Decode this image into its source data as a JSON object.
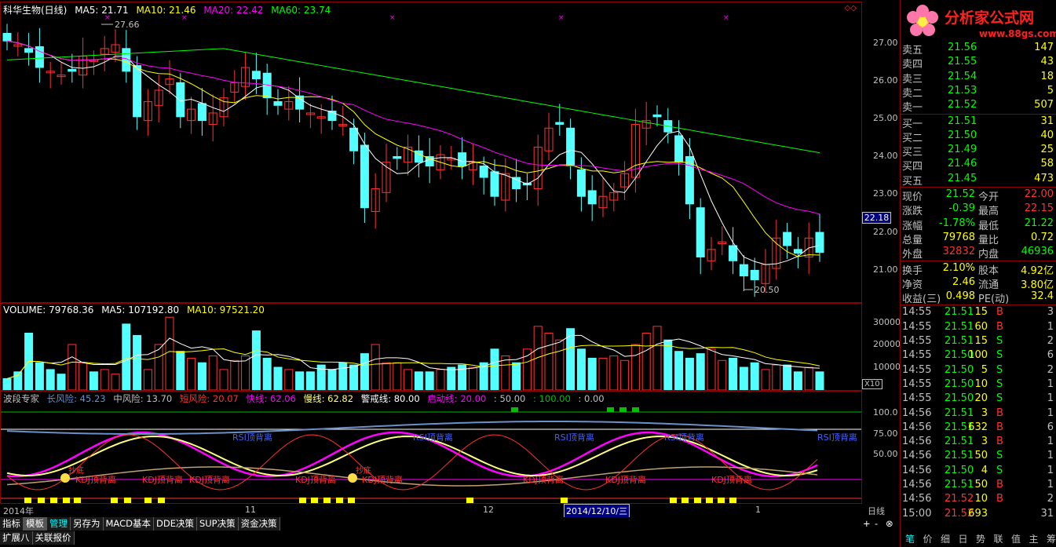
{
  "main": {
    "title": "科华生物(日线)",
    "ma5": "MA5: 21.71",
    "ma10": "MA10: 21.46",
    "ma20": "MA20: 22.42",
    "ma60": "MA60: 23.74",
    "high_note": "27.66",
    "low_note": "20.50",
    "current_price_tag": "22.18",
    "y_ticks": [
      "27.00",
      "26.00",
      "25.00",
      "24.00",
      "23.00",
      "22.00",
      "21.00"
    ]
  },
  "volume": {
    "title": "VOLUME: 79768.36",
    "ma5": "MA5: 107192.80",
    "ma10": "MA10: 97521.20",
    "y_ticks": [
      "30000",
      "20000",
      "10000"
    ],
    "unit": "X10"
  },
  "indicator": {
    "name": "波段专家",
    "long_risk": "长风险: 45.23",
    "mid_risk": "中风险: 13.70",
    "short_risk": "短风险: 20.07",
    "fast": "快线: 62.06",
    "slow": "慢线: 62.82",
    "warn": "警戒线: 80.00",
    "start": "启动线: 20.00",
    "v1": ": 50.00",
    "v2": ": 100.00",
    "v3": ": 0.00",
    "y_ticks": [
      "100.0",
      "75.00",
      "50.00"
    ],
    "labels_rsi": [
      "RSI顶背离",
      "RSI顶背离",
      "RSI顶背离",
      "RSI顶背离",
      "RSI顶背离"
    ],
    "labels_kdj": [
      "KDJ顶背离",
      "KDJ顶背离",
      "KDJ顶背离",
      "KDJ顶背离",
      "KDJ顶背离",
      "KDJ顶背离",
      "KDJ顶背离",
      "KDJ顶背离"
    ],
    "label_buy": "抄底"
  },
  "time_axis": {
    "labels": [
      "2014年",
      "11",
      "12",
      "1"
    ],
    "cursor_date": "2014/12/10/三",
    "period": "日线"
  },
  "tabs": [
    "指标",
    "模板",
    "管理",
    "另存为",
    "MACD基本",
    "DDE决策",
    "SUP决策",
    "资金决策"
  ],
  "tabs2": [
    "扩展八",
    "关联报价"
  ],
  "zoom": [
    "+",
    "-",
    "⊗"
  ],
  "logo": {
    "text": "分析家公式网",
    "url": "www.88gs.com"
  },
  "order_book": {
    "sell": [
      [
        "卖五",
        "21.56",
        "147"
      ],
      [
        "卖四",
        "21.55",
        "43"
      ],
      [
        "卖三",
        "21.54",
        "18"
      ],
      [
        "卖二",
        "21.53",
        "5"
      ],
      [
        "卖一",
        "21.52",
        "507"
      ]
    ],
    "buy": [
      [
        "买一",
        "21.51",
        "31"
      ],
      [
        "买二",
        "21.50",
        "40"
      ],
      [
        "买三",
        "21.49",
        "25"
      ],
      [
        "买四",
        "21.46",
        "58"
      ],
      [
        "买五",
        "21.45",
        "473"
      ]
    ]
  },
  "quote": [
    [
      "现价",
      "21.52",
      "今开",
      "22.00"
    ],
    [
      "涨跌",
      "-0.39",
      "最高",
      "22.15"
    ],
    [
      "涨幅",
      "-1.78%",
      "最低",
      "21.22"
    ],
    [
      "总量",
      "79768",
      "量比",
      "0.72"
    ],
    [
      "外盘",
      "32832",
      "内盘",
      "46936"
    ]
  ],
  "quote2": [
    [
      "换手",
      "2.10%",
      "股本",
      "4.92亿"
    ],
    [
      "净资",
      "2.46",
      "流通",
      "3.80亿"
    ],
    [
      "收益(三)",
      "0.498",
      "PE(动)",
      "32.4"
    ]
  ],
  "ticks": [
    [
      "14:55",
      "21.51",
      "15",
      "B",
      "3"
    ],
    [
      "14:55",
      "21.51",
      "60",
      "B",
      "1"
    ],
    [
      "14:55",
      "21.51",
      "15",
      "S",
      "2"
    ],
    [
      "14:55",
      "21.50",
      "100",
      "S",
      "6"
    ],
    [
      "14:55",
      "21.50",
      "5",
      "S",
      "2"
    ],
    [
      "14:55",
      "21.50",
      "10",
      "S",
      "1"
    ],
    [
      "14:55",
      "21.50",
      "20",
      "S",
      "1"
    ],
    [
      "14:56",
      "21.51",
      "3",
      "B",
      "1"
    ],
    [
      "14:56",
      "21.51",
      "632",
      "B",
      "6"
    ],
    [
      "14:56",
      "21.51",
      "3",
      "B",
      "1"
    ],
    [
      "14:56",
      "21.51",
      "50",
      "S",
      "1"
    ],
    [
      "14:56",
      "21.50",
      "4",
      "S",
      "1"
    ],
    [
      "14:56",
      "21.51",
      "50",
      "B",
      "1"
    ],
    [
      "14:56",
      "21.52",
      "10",
      "B",
      "2"
    ],
    [
      "15:00",
      "21.52",
      "693",
      "",
      "31"
    ]
  ],
  "bottom_nav": [
    "笔",
    "价",
    "细",
    "日",
    "势",
    "联",
    "值",
    "主",
    "筹"
  ],
  "colors": {
    "up": "#ff3232",
    "down": "#54ffff",
    "ma5": "#ffffff",
    "ma10": "#ffff00",
    "ma20": "#ff00ff",
    "ma60": "#00ff00",
    "frame": "#8b0000"
  }
}
